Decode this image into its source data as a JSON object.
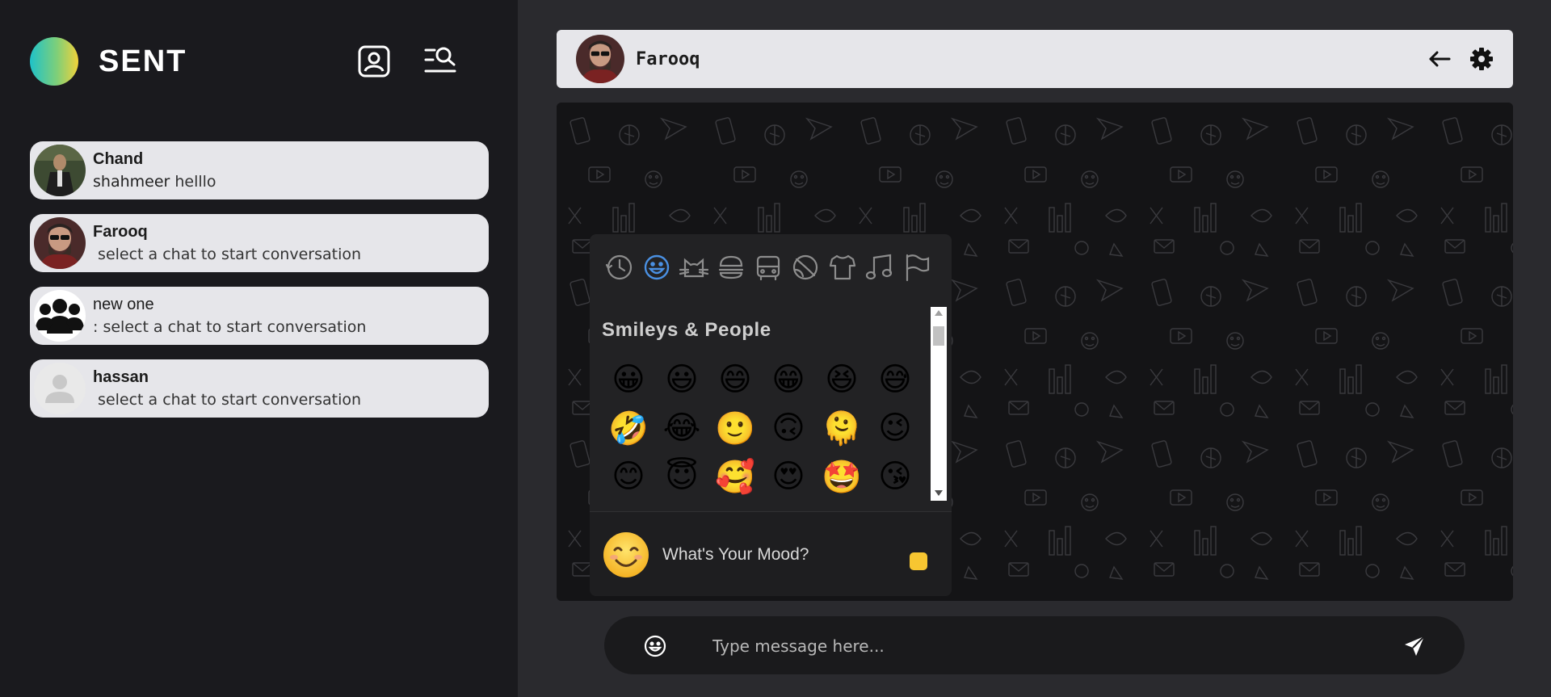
{
  "app": {
    "name": "SENT",
    "accent_gradient": [
      "#1fc2c9",
      "#f1d23a"
    ]
  },
  "sidebar": {
    "actions": [
      {
        "icon": "contact-card-icon"
      },
      {
        "icon": "search-list-icon"
      }
    ],
    "chats": [
      {
        "name": "Chand",
        "sender": "shahmeer",
        "message": " helllo",
        "avatar": "photo-dark-suit"
      },
      {
        "name": "Farooq",
        "sender": "",
        "message": " select a chat to start conversation",
        "avatar": "photo-bearded-man"
      },
      {
        "name": "new one",
        "sender": "",
        "message": ": select a chat to start conversation",
        "avatar": "group-icon"
      },
      {
        "name": "hassan",
        "sender": "",
        "message": " select a chat to start conversation",
        "avatar": "default-user-icon"
      }
    ]
  },
  "conversation": {
    "contact_name": "Farooq",
    "actions": [
      {
        "icon": "back-arrow-icon"
      },
      {
        "icon": "gear-icon"
      }
    ]
  },
  "emoji_picker": {
    "categories": [
      "recent-icon",
      "smileys-icon",
      "animals-icon",
      "food-icon",
      "travel-icon",
      "activity-icon",
      "objects-icon",
      "symbols-icon",
      "flags-icon"
    ],
    "active_category": "smileys-icon",
    "section_title": "Smileys & People",
    "emojis": [
      "😀",
      "😃",
      "😄",
      "😁",
      "😆",
      "😅",
      "🤣",
      "😂",
      "🙂",
      "🙃",
      "🫠",
      "😉",
      "😊",
      "😇",
      "🥰",
      "😍",
      "🤩",
      "😘"
    ],
    "preview_emoji": "😊",
    "preview_text": "What's Your Mood?",
    "skin_tone_color": "#f7c631"
  },
  "composer": {
    "placeholder": "Type message here...",
    "emoji_button_icon": "smiley-icon",
    "send_button_icon": "send-icon"
  }
}
